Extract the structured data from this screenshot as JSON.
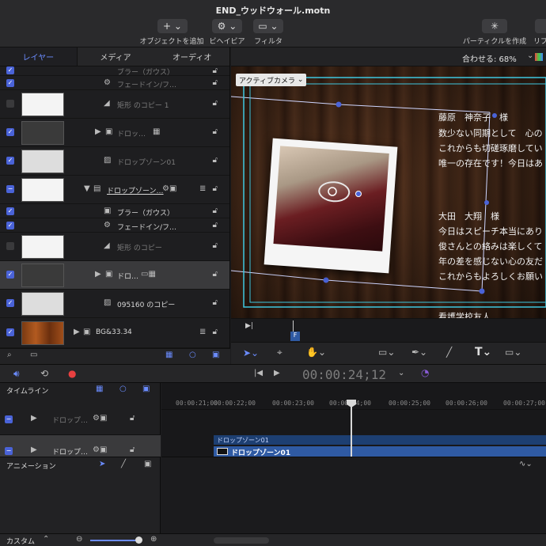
{
  "window": {
    "title": "END_ウッドウォール.motn"
  },
  "toolbar": {
    "add_object_label": "オブジェクトを追加",
    "behaviors_label": "ビヘイビア",
    "filters_label": "フィルタ",
    "particles_label": "パーティクルを作成",
    "replicator_label": "リプ",
    "add_glyph": "+",
    "behaviors_glyph": "⚙",
    "filters_glyph": "▭"
  },
  "layers_panel": {
    "tabs": [
      {
        "label": "レイヤー",
        "active": true
      },
      {
        "label": "メディア",
        "active": false
      },
      {
        "label": "オーディオ",
        "active": false
      }
    ],
    "rows": [
      {
        "name": "ブラー（ガウス）",
        "checked": true,
        "dim": true
      },
      {
        "name": "フェードイン/フ…",
        "checked": true,
        "dim": true
      },
      {
        "name": "矩形 のコピー 1",
        "checked": false,
        "dim": true
      },
      {
        "name": "ドロッ…",
        "checked": true,
        "dim": true
      },
      {
        "name": "ドロップゾーン01",
        "checked": true,
        "dim": true
      },
      {
        "name": "ドロップゾーン…",
        "checked": true,
        "dim": false
      },
      {
        "name": "ブラー（ガウス）",
        "checked": true,
        "dim": false
      },
      {
        "name": "フェードイン/フ…",
        "checked": true,
        "dim": false
      },
      {
        "name": "矩形 のコピー",
        "checked": false,
        "dim": true
      },
      {
        "name": "ドロ…",
        "checked": true,
        "dim": false
      },
      {
        "name": "095160 のコピー",
        "checked": true,
        "dim": false
      },
      {
        "name": "BG&33.34",
        "checked": true,
        "dim": false
      }
    ]
  },
  "canvas": {
    "fit_label": "合わせる: 68%",
    "camera_label": "アクティブカメラ",
    "message_lines": [
      "藤原　神奈子　様",
      "数少ない同期として　心の",
      "これからも切磋琢磨してい",
      "唯一の存在です！今日はあ",
      "",
      "大田　大翔　様",
      "今日はスピーチ本当にあり",
      "俊さんとの絡みは楽しくて",
      "年の差を感じない心の友だ",
      "これからもよろしくお願い",
      "",
      "看護学校友人"
    ]
  },
  "transport": {
    "timecode": "00:00:24;12"
  },
  "timeline": {
    "label": "タイムライン",
    "ticks": [
      "00:00:21;00",
      "00:00:22;00",
      "00:00:23;00",
      "00:00:24;00",
      "00:00:25;00",
      "00:00:26;00",
      "00:00:27;00"
    ],
    "track1": "ドロップ…",
    "track2": "ドロップ…",
    "clip1": "ドロップゾーン01",
    "clip2": "ドロップゾーン01"
  },
  "animation": {
    "label": "アニメーション"
  },
  "bottom": {
    "preset_label": "カスタム"
  },
  "colors": {
    "accent": "#4a63d8",
    "clip": "#2f5aa3",
    "timecode": "#7d7d7d"
  }
}
